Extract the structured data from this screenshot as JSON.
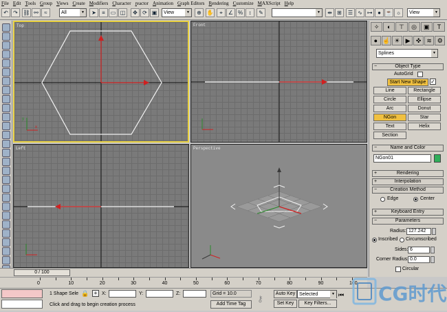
{
  "menu": [
    "File",
    "Edit",
    "Tools",
    "Group",
    "Views",
    "Create",
    "Modifiers",
    "Character",
    "reactor",
    "Animation",
    "Graph Editors",
    "Rendering",
    "Customize",
    "MAXScript",
    "Help"
  ],
  "toolbar": {
    "filter_value": "All",
    "refcoord_value": "View",
    "named_sel": "",
    "view_right": "View"
  },
  "viewports": {
    "top": "Top",
    "front": "Front",
    "left": "Left",
    "perspective": "Perspective"
  },
  "panel": {
    "category": "Splines",
    "object_type_title": "Object Type",
    "autogrid": "AutoGrid",
    "start_new_shape": "Start New Shape",
    "buttons": [
      "Line",
      "Rectangle",
      "Circle",
      "Ellipse",
      "Arc",
      "Donut",
      "NGon",
      "Star",
      "Text",
      "Helix",
      "Section"
    ],
    "name_color_title": "Name and Color",
    "object_name": "NGon01",
    "object_color": "#2fae5a",
    "rendering": "Rendering",
    "interpolation": "Interpolation",
    "creation_method": "Creation Method",
    "edge": "Edge",
    "center": "Center",
    "keyboard_entry": "Keyboard Entry",
    "parameters": "Parameters",
    "radius_label": "Radius:",
    "radius_value": "127.242",
    "inscribed": "Inscribed",
    "circumscribed": "Circumscribed",
    "sides_label": "Sides:",
    "sides_value": "6",
    "corner_label": "Corner Radius:",
    "corner_value": "0.0",
    "circular": "Circular"
  },
  "timeline": {
    "slider": "0 / 100",
    "ticks": [
      "0",
      "10",
      "20",
      "30",
      "40",
      "50",
      "60",
      "70",
      "80",
      "90",
      "100"
    ]
  },
  "status": {
    "selection": "1 Shape Sele",
    "x_label": "X:",
    "y_label": "Y:",
    "z_label": "Z:",
    "grid": "Grid = 10.0",
    "auto_key": "Auto Key",
    "selected": "Selected",
    "set_key": "Set Key",
    "key_filters": "Key Filters...",
    "add_time_tag": "Add Time Tag",
    "prompt": "Click and drag to begin creation process"
  },
  "logo": {
    "text": "CG时代"
  }
}
